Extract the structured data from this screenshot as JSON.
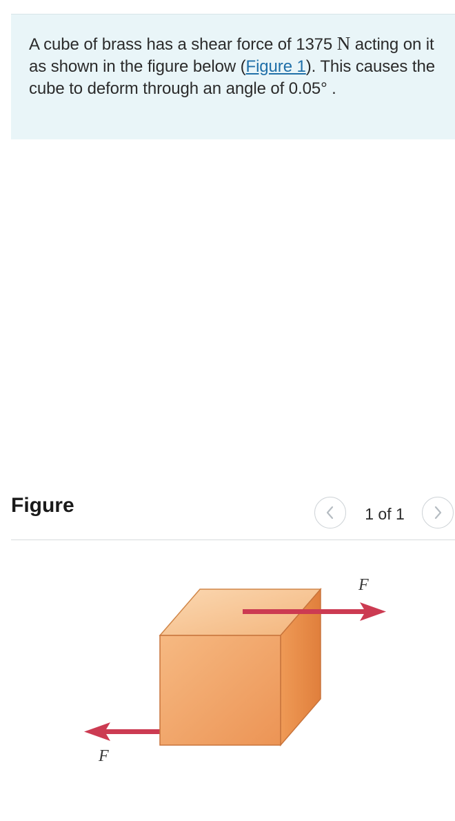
{
  "problem": {
    "text_part1": "A cube of brass has a shear force of 1375 ",
    "unit_symbol": "N",
    "text_part2": " acting on it as shown in the figure below (",
    "figure_link_label": "Figure 1",
    "text_part3": "). This causes the cube to deform through an angle of 0.05° ."
  },
  "figure_panel": {
    "heading": "Figure",
    "pager_text": "1 of 1",
    "prev_icon": "chevron-left-icon",
    "next_icon": "chevron-right-icon"
  },
  "figure": {
    "force_label_top": "F",
    "force_label_bottom": "F",
    "colors": {
      "cube_front": "#f0a466",
      "cube_top": "#f7c896",
      "cube_side": "#e88a45",
      "cube_edge": "#c8743c",
      "arrow": "#cc3b52",
      "panel_bg": "#e9f5f8",
      "link": "#1f6fa8"
    }
  }
}
